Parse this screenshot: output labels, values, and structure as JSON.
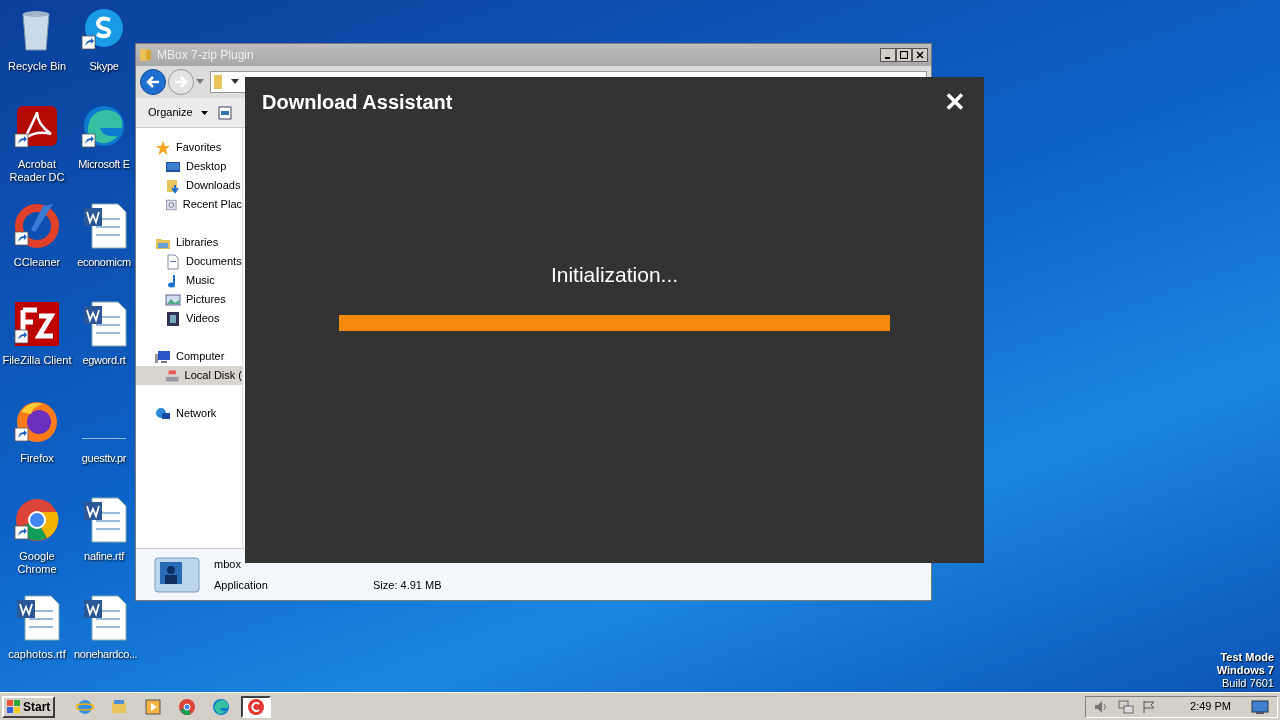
{
  "desktop_icons": [
    {
      "label": "Recycle Bin",
      "kind": "recycle",
      "shortcut": false
    },
    {
      "label": "Skype",
      "kind": "skype",
      "shortcut": true
    },
    {
      "label": "Acrobat Reader DC",
      "kind": "acrobat",
      "shortcut": true
    },
    {
      "label": "Microsoft E",
      "kind": "edge",
      "shortcut": true
    },
    {
      "label": "CCleaner",
      "kind": "ccleaner",
      "shortcut": true
    },
    {
      "label": "economicm",
      "kind": "word",
      "shortcut": false
    },
    {
      "label": "FileZilla Client",
      "kind": "filezilla",
      "shortcut": true
    },
    {
      "label": "egword.rt",
      "kind": "word",
      "shortcut": false
    },
    {
      "label": "Firefox",
      "kind": "firefox",
      "shortcut": true
    },
    {
      "label": "guesttv.pr",
      "kind": "blank",
      "shortcut": false
    },
    {
      "label": "Google Chrome",
      "kind": "chrome",
      "shortcut": true
    },
    {
      "label": "nafine.rtf",
      "kind": "word",
      "shortcut": false
    },
    {
      "label": "caphotos.rtf",
      "kind": "word",
      "shortcut": false
    },
    {
      "label": "nonehardco...",
      "kind": "word",
      "shortcut": false
    }
  ],
  "explorer": {
    "title": "MBox 7-zip Plugin",
    "organize": "Organize",
    "nav": [
      {
        "label": "Favorites",
        "kind": "star",
        "selected": false,
        "children": [
          {
            "label": "Desktop",
            "kind": "desktop",
            "selected": false
          },
          {
            "label": "Downloads",
            "kind": "downloads",
            "selected": false
          },
          {
            "label": "Recent Plac",
            "kind": "recent",
            "selected": false
          }
        ]
      },
      {
        "label": "Libraries",
        "kind": "library",
        "selected": false,
        "children": [
          {
            "label": "Documents",
            "kind": "document",
            "selected": false
          },
          {
            "label": "Music",
            "kind": "music",
            "selected": false
          },
          {
            "label": "Pictures",
            "kind": "pictures",
            "selected": false
          },
          {
            "label": "Videos",
            "kind": "videos",
            "selected": false
          }
        ]
      },
      {
        "label": "Computer",
        "kind": "computer",
        "selected": false,
        "children": [
          {
            "label": "Local Disk (",
            "kind": "disk",
            "selected": true
          }
        ]
      },
      {
        "label": "Network",
        "kind": "network",
        "selected": false
      }
    ],
    "details": {
      "name": "mbox",
      "type": "Application",
      "size": "Size: 4.91 MB"
    }
  },
  "dialog": {
    "title": "Download Assistant",
    "close": "✕",
    "status": "Initialization...",
    "progress": {
      "level": 1
    }
  },
  "taskbar": {
    "start": "Start",
    "apps": [
      {
        "kind": "ie",
        "active": false
      },
      {
        "kind": "explorer",
        "active": false
      },
      {
        "kind": "media",
        "active": false
      },
      {
        "kind": "chrome",
        "active": false
      },
      {
        "kind": "edge",
        "active": false
      },
      {
        "kind": "ccleaner",
        "active": true
      }
    ],
    "time": "2:49 PM"
  },
  "test_mode": [
    "Test Mode",
    "Windows 7",
    "Build 7601"
  ]
}
